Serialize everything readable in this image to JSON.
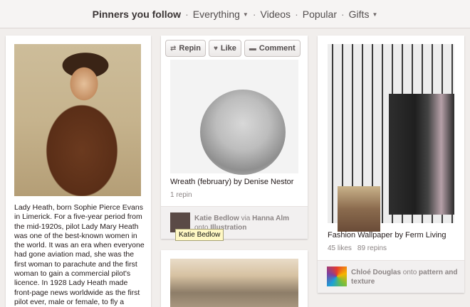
{
  "nav": {
    "items": [
      {
        "label": "Pinners you follow",
        "active": true,
        "dropdown": false
      },
      {
        "label": "Everything",
        "active": false,
        "dropdown": true
      },
      {
        "label": "Videos",
        "active": false,
        "dropdown": false
      },
      {
        "label": "Popular",
        "active": false,
        "dropdown": false
      },
      {
        "label": "Gifts",
        "active": false,
        "dropdown": true
      }
    ]
  },
  "pins": {
    "lady_heath": {
      "description": "Lady Heath, born Sophie Pierce Evans in Limerick. For a five-year period from the mid-1920s, pilot Lady Mary Heath was one of the best-known women in the world. It was an era when everyone had gone aviation mad, she was the first woman to parachute and the first woman to gain a commercial pilot's licence. In 1928 Lady Heath made front-page news worldwide as the first pilot ever, male or female, to fly a small,"
    },
    "wreath": {
      "actions": {
        "repin": "Repin",
        "like": "Like",
        "comment": "Comment"
      },
      "title": "Wreath (february) by Denise Nestor",
      "repins": "1 repin",
      "attribution": {
        "user": "Katie Bedlow",
        "via_word": "via",
        "via_user": "Hanna Alm",
        "onto_word": "onto",
        "board": "Illustration"
      },
      "tooltip": "Katie Bedlow"
    },
    "fashion": {
      "title": "Fashion Wallpaper by Ferm Living",
      "likes": "45 likes",
      "repins": "89 repins",
      "attribution": {
        "user": "Chloé Douglas",
        "onto_word": "onto",
        "board": "pattern and texture"
      }
    }
  },
  "icons": {
    "repin": "repin-icon",
    "like": "heart-icon",
    "comment": "comment-icon",
    "caret": "caret-down-icon"
  }
}
